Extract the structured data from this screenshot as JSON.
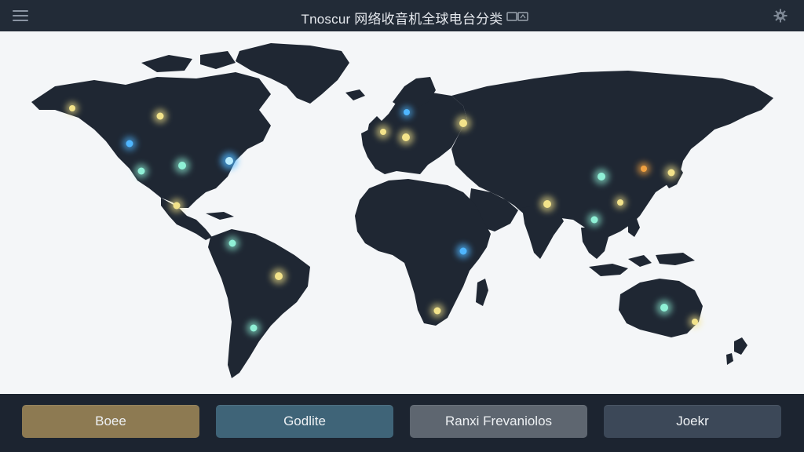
{
  "app": {
    "title": "Tnoscur 网络收音机全球电台分类"
  },
  "icons": {
    "menu": "hamburger-menu-icon",
    "title_aux": "window-icon",
    "settings": "gear-icon"
  },
  "colors": {
    "topbar": "#222b37",
    "map_background": "#f4f6f8",
    "land": "#1f2733",
    "bottombar": "#1c2430",
    "station_yellow": "#f3e38a",
    "station_teal": "#8ff0d6",
    "station_blue": "#4fb6ff",
    "station_orange": "#f0a040"
  },
  "stations": [
    {
      "id": "alaska",
      "color": "#f3e38a"
    },
    {
      "id": "canada-west",
      "color": "#f3e38a"
    },
    {
      "id": "pacific-nw",
      "color": "#4fb6ff"
    },
    {
      "id": "california",
      "color": "#8ff0d6"
    },
    {
      "id": "us-central",
      "color": "#8ff0d6"
    },
    {
      "id": "us-east",
      "color": "#4fb6ff"
    },
    {
      "id": "mexico",
      "color": "#f3e38a"
    },
    {
      "id": "colombia",
      "color": "#8ff0d6"
    },
    {
      "id": "brazil",
      "color": "#f3e38a"
    },
    {
      "id": "argentina",
      "color": "#8ff0d6"
    },
    {
      "id": "scandinavia",
      "color": "#4fb6ff"
    },
    {
      "id": "uk",
      "color": "#f3e38a"
    },
    {
      "id": "central-europe",
      "color": "#f3e38a"
    },
    {
      "id": "russia-west",
      "color": "#f3e38a"
    },
    {
      "id": "east-africa",
      "color": "#4fb6ff"
    },
    {
      "id": "south-africa",
      "color": "#f3e38a"
    },
    {
      "id": "india",
      "color": "#f3e38a"
    },
    {
      "id": "china",
      "color": "#8ff0d6"
    },
    {
      "id": "korea",
      "color": "#f0a040"
    },
    {
      "id": "japan",
      "color": "#f3e38a"
    },
    {
      "id": "se-asia",
      "color": "#8ff0d6"
    },
    {
      "id": "philippines",
      "color": "#f3e38a"
    },
    {
      "id": "australia",
      "color": "#8ff0d6"
    },
    {
      "id": "sydney",
      "color": "#f3e38a"
    }
  ],
  "categories": [
    {
      "label": "Boee",
      "color": "#8d7a52"
    },
    {
      "label": "Godlite",
      "color": "#3f6478"
    },
    {
      "label": "Ranxi Frevaniolos",
      "color": "#5e6670"
    },
    {
      "label": "Joekr",
      "color": "#3c4858"
    }
  ]
}
